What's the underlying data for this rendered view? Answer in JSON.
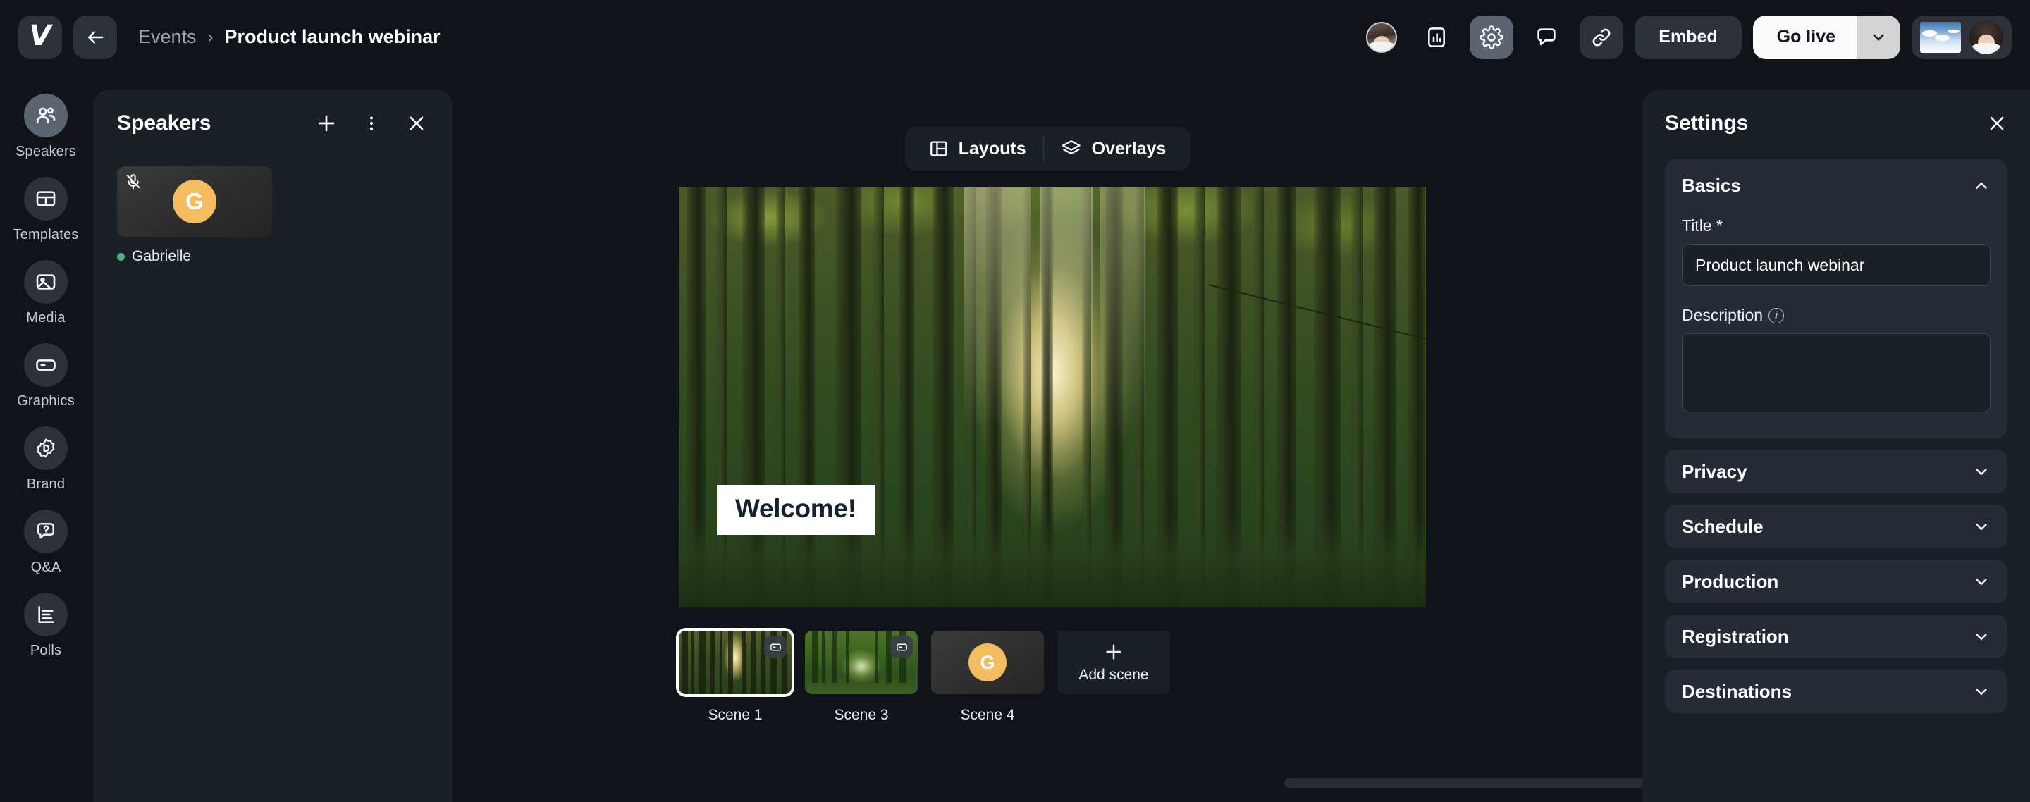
{
  "topbar": {
    "logo": "vimeo-logo",
    "back_label": "back-arrow",
    "breadcrumb_parent": "Events",
    "breadcrumb_separator": "›",
    "breadcrumb_current": "Product launch webinar",
    "embed_label": "Embed",
    "golive_label": "Go live",
    "icons": [
      "participant-avatar-icon",
      "analytics-icon",
      "settings-gear-icon",
      "chat-icon",
      "link-icon"
    ]
  },
  "rail": {
    "items": [
      {
        "label": "Speakers",
        "icon": "people-icon",
        "active": true
      },
      {
        "label": "Templates",
        "icon": "layout-icon",
        "active": false
      },
      {
        "label": "Media",
        "icon": "image-icon",
        "active": false
      },
      {
        "label": "Graphics",
        "icon": "graphics-icon",
        "active": false
      },
      {
        "label": "Brand",
        "icon": "brand-icon",
        "active": false
      },
      {
        "label": "Q&A",
        "icon": "question-icon",
        "active": false
      },
      {
        "label": "Polls",
        "icon": "polls-icon",
        "active": false
      }
    ]
  },
  "speakers": {
    "title": "Speakers",
    "add_label": "+",
    "more_label": "⋮",
    "close_label": "✕",
    "list": [
      {
        "initial": "G",
        "name": "Gabrielle",
        "status": "online",
        "muted": true
      }
    ]
  },
  "stage": {
    "mode_layouts": "Layouts",
    "mode_overlays": "Overlays",
    "overlay_text": "Welcome!",
    "scenes": [
      {
        "label": "Scene 1",
        "type": "image-sunlit-forest",
        "selected": true,
        "has_badge": true
      },
      {
        "label": "Scene 3",
        "type": "image-forest-path",
        "selected": false,
        "has_badge": true
      },
      {
        "label": "Scene 4",
        "type": "speaker-avatar",
        "selected": false,
        "has_badge": false,
        "initial": "G"
      }
    ],
    "add_scene_label": "Add scene"
  },
  "settings": {
    "title": "Settings",
    "close_label": "✕",
    "basics": {
      "title": "Basics",
      "title_field_label": "Title *",
      "title_value": "Product launch webinar",
      "description_label": "Description",
      "description_value": "",
      "description_placeholder": ""
    },
    "sections": [
      {
        "label": "Privacy"
      },
      {
        "label": "Schedule"
      },
      {
        "label": "Production"
      },
      {
        "label": "Registration"
      },
      {
        "label": "Destinations"
      }
    ]
  },
  "colors": {
    "page_bg": "#101319",
    "panel_bg": "#1b1f26",
    "card_bg": "#262b35",
    "accent_yellow": "#f4bd5f",
    "online_green": "#4caf7d",
    "active_rail": "#5a6570"
  }
}
